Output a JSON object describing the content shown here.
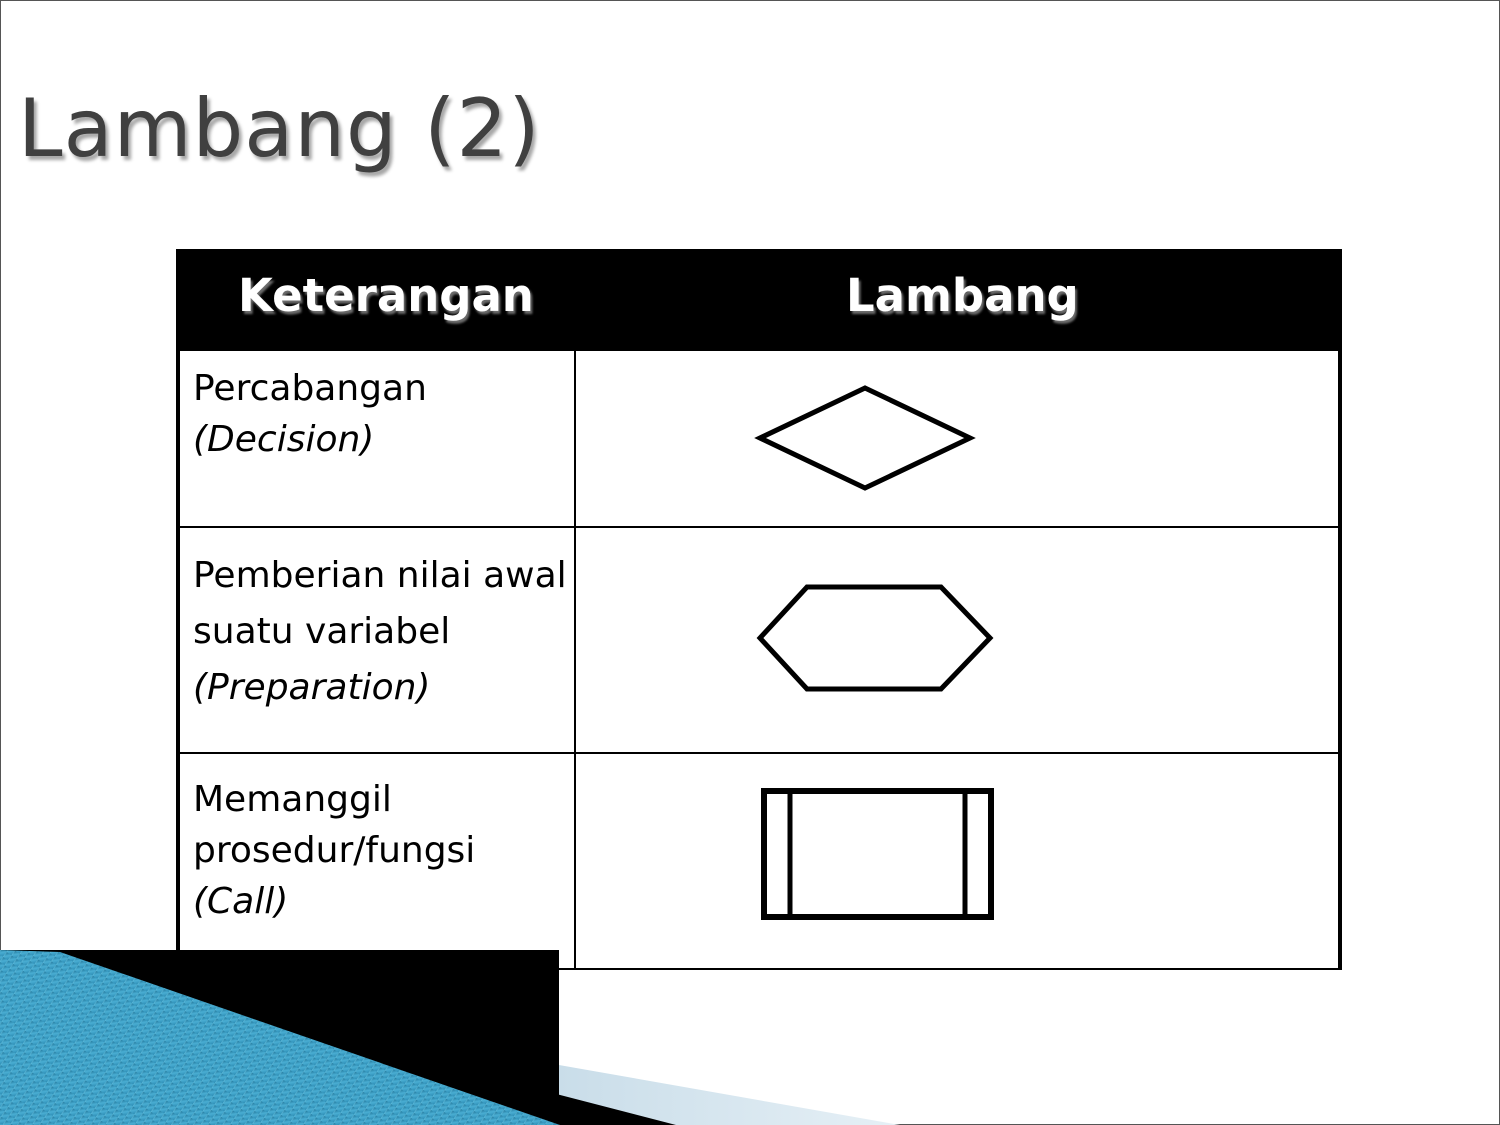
{
  "slide": {
    "title": "Lambang (2)"
  },
  "table": {
    "headers": {
      "keterangan": "Keterangan",
      "lambang": "Lambang"
    },
    "rows": [
      {
        "lines": [
          "Percabangan"
        ],
        "english": "(Decision)",
        "symbol": "diamond-shape"
      },
      {
        "lines": [
          "Pemberian nilai awal",
          "suatu variabel"
        ],
        "english": "(Preparation)",
        "symbol": "hexagon-shape"
      },
      {
        "lines": [
          "Memanggil",
          "prosedur/fungsi"
        ],
        "english": "(Call)",
        "symbol": "predefined-process-shape"
      }
    ]
  },
  "colors": {
    "header_background": "#000000",
    "header_text": "#ffffff",
    "title_text": "#404040",
    "deco_blue": "#3a9cc4",
    "deco_light": "#d6e6f0"
  }
}
